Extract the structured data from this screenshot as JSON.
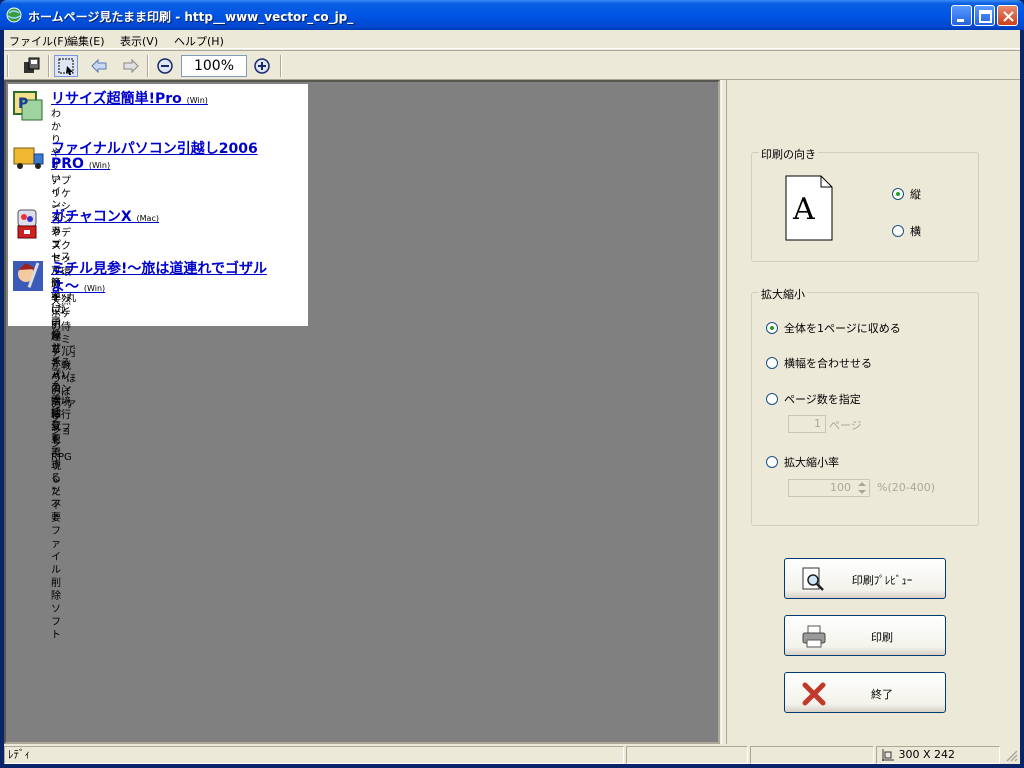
{
  "window": {
    "title": "ホームページ見たまま印刷 - http__www_vector_co_jp_"
  },
  "menu": [
    "ファイル(F)",
    "編集(E)",
    "表示(V)",
    "ヘルプ(H)"
  ],
  "toolbar": {
    "zoom": "100%",
    "icons": [
      "print-setup-icon",
      "select-icon",
      "back-arrow-icon",
      "forward-arrow-icon",
      "zoom-out-icon",
      "zoom-in-icon"
    ]
  },
  "preview": {
    "entries": [
      {
        "title": "リサイズ超簡単!Pro",
        "tag": "(Win)",
        "desc_1": "わかりやすいインタフェースで、簡単に画像サイ",
        "desc_2": "ズを一括変更できるソフト"
      },
      {
        "title_1": "ファイナルパソコン引越し2006",
        "title_2": "PRO",
        "tag": "(Win)",
        "desc_1": "アプリケーションやデスクトップ環境を“丸ごと引",
        "desc_2": "越し”できるパソコン環境移行ソフト"
      },
      {
        "title": "ガチャコンX",
        "tag": "(Mac)",
        "desc_1": "カプセルトイ(ガチャガチャ)の雰囲気を再現した",
        "desc_2": "不要ファイル削除ソフト"
      },
      {
        "title_1": "ミチル見参!～旅は道連れでゴザル",
        "title_2": "よ～",
        "tag": "(Win)",
        "desc_1": "天然ボケの侍「ミチル」が戦う“ほのぼの”アク",
        "desc_2": "ションRPG"
      }
    ]
  },
  "orientation": {
    "label": "印刷の向き",
    "page_letter": "A",
    "portrait": "縦",
    "landscape": "横",
    "selected": "portrait"
  },
  "scale": {
    "label": "拡大縮小",
    "fit_page": "全体を1ページに収める",
    "fit_width": "横幅を合わせせる",
    "pages": "ページ数を指定",
    "pages_value": "1",
    "pages_unit": "ページ",
    "ratio": "拡大縮小率",
    "ratio_value": "100",
    "ratio_unit": "%(20-400)",
    "selected": "fit_page"
  },
  "buttons": {
    "preview": "印刷ﾌﾟﾚﾋﾞｭｰ",
    "print": "印刷",
    "exit": "終了"
  },
  "status": {
    "text": "ﾚﾃﾞｨ",
    "size": "300 X 242"
  },
  "colors": {
    "title_bar": "#0055e5",
    "link": "#0000cc",
    "view_background": "#808080"
  }
}
